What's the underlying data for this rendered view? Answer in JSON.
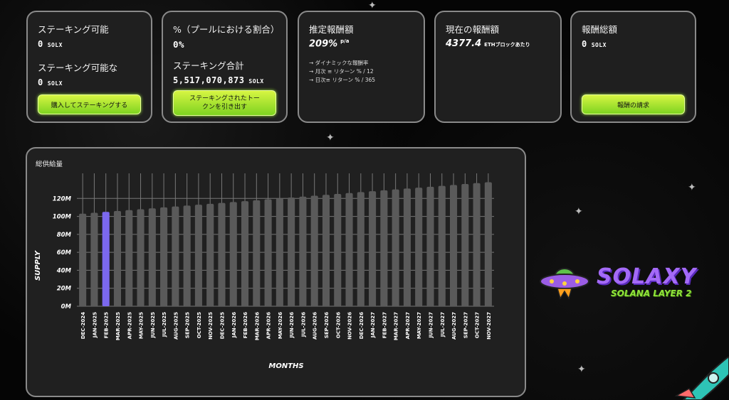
{
  "cards": {
    "stakeable": {
      "label": "ステーキング可能",
      "value": "0",
      "unit": "SOLX"
    },
    "stakeable2": {
      "label": "ステーキング可能な",
      "value": "0",
      "unit": "SOLX"
    },
    "buy_button": "購入してステーキングする",
    "pool_label": "%（プールにおける割合）",
    "pool_value": "0%",
    "total_label": "ステーキング合計",
    "total_value": "5,517,070,873",
    "total_unit": "SOLX",
    "withdraw_button": "ステーキングされたトークンを引き出す",
    "apy_label": "推定報酬額",
    "apy_value": "209%",
    "apy_unit": "p/a",
    "apy_bullets": [
      "→ ダイナミックな報酬率",
      "→ 月次 ≡ リターン % / 12",
      "→ 日次≡ リターン % / 365"
    ],
    "current_label": "現在の報酬額",
    "current_value": "4377.4",
    "current_unit": "ETHブロックあたり",
    "total_rewards_label": "報酬総額",
    "total_rewards_value": "0",
    "total_rewards_unit": "SOLX",
    "claim_button": "報酬の請求"
  },
  "chart_title": "総供給量",
  "brand": {
    "name": "SOLAXY",
    "subtitle": "SOLANA LAYER 2"
  },
  "chart_data": {
    "type": "bar",
    "xlabel": "MONTHS",
    "ylabel": "SUPPLY",
    "ylim": [
      0,
      140
    ],
    "yticks": [
      "0M",
      "20M",
      "40M",
      "60M",
      "80M",
      "100M",
      "120M"
    ],
    "highlight_index": 2,
    "highlight_color": "#7b68ee",
    "bar_color": "#5a5a5a",
    "categories": [
      "DEC-2024",
      "JAN-2025",
      "FEB-2025",
      "MAR-2025",
      "APR-2025",
      "MAY-2025",
      "JUN-2025",
      "JUL-2025",
      "AUG-2025",
      "SEP-2025",
      "OCT-2025",
      "NOV-2025",
      "DEC-2025",
      "JAN-2026",
      "FEB-2026",
      "MAR-2026",
      "APR-2026",
      "MAY-2026",
      "JUN-2026",
      "JUL-2026",
      "AUG-2026",
      "SEP-2026",
      "OCT-2026",
      "NOV-2026",
      "DEC-2026",
      "JAN-2027",
      "FEB-2027",
      "MAR-2027",
      "APR-2027",
      "MAY-2027",
      "JUN-2027",
      "JUL-2027",
      "AUG-2027",
      "SEP-2027",
      "OCT-2027",
      "NOV-2027"
    ],
    "values": [
      103,
      104,
      105,
      106,
      107,
      108,
      109,
      110,
      111,
      112,
      113,
      114,
      115,
      116,
      117,
      118,
      119,
      120,
      121,
      122,
      123,
      124,
      125,
      126,
      127,
      128,
      129,
      130,
      131,
      132,
      133,
      134,
      135,
      136,
      137,
      138
    ]
  }
}
